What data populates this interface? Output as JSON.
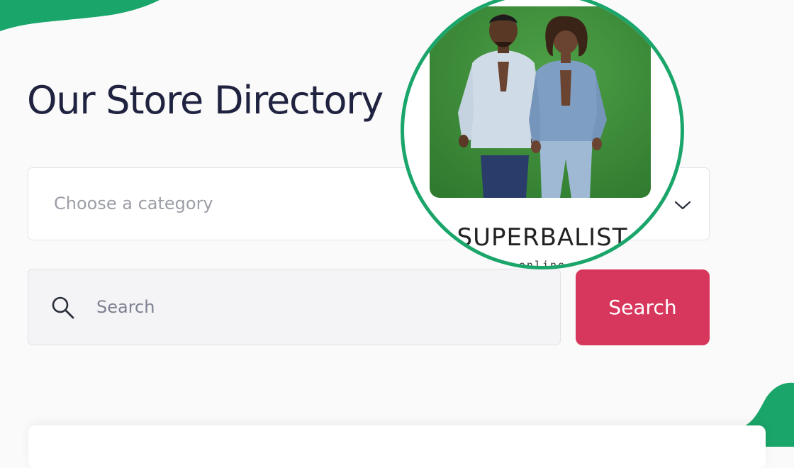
{
  "directory": {
    "title": "Our Store Directory"
  },
  "category_select": {
    "placeholder": "Choose a category",
    "icon": "chevron-down-icon"
  },
  "search": {
    "placeholder": "Search",
    "value": "",
    "icon": "search-icon",
    "button_label": "Search"
  },
  "promo": {
    "brand_name": "SUPERBALIST",
    "tagline": "online"
  },
  "colors": {
    "title_text": "#1f2340",
    "search_button": "#d8375d",
    "accent_green": "#1aa56a",
    "photo_background": "#3f8f3a",
    "page_background": "#fafafa"
  }
}
